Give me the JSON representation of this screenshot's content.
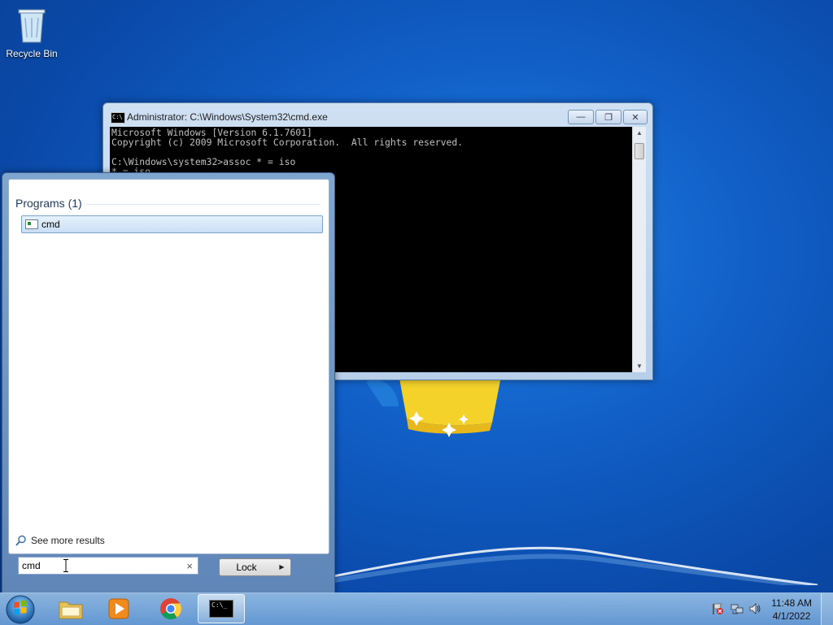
{
  "desktop": {
    "recycle_bin_label": "Recycle Bin"
  },
  "cmd_window": {
    "title": "Administrator: C:\\Windows\\System32\\cmd.exe",
    "icon_text": "C:\\",
    "console_lines": [
      "Microsoft Windows [Version 6.1.7601]",
      "Copyright (c) 2009 Microsoft Corporation.  All rights reserved.",
      "",
      "C:\\Windows\\system32>assoc * = iso",
      "* = iso"
    ],
    "minimize_glyph": "—",
    "restore_glyph": "❐",
    "close_glyph": "✕"
  },
  "start_menu": {
    "programs_header": "Programs (1)",
    "results": [
      {
        "label": "cmd"
      }
    ],
    "see_more": "See more results",
    "search_value": "cmd",
    "clear_glyph": "×",
    "lock_label": "Lock",
    "lock_arrow": "▶"
  },
  "taskbar": {
    "cmd_button_text": "C:\\_",
    "clock_time": "11:48 AM",
    "clock_date": "4/1/2022"
  },
  "colors": {
    "desktop_blue": "#1160c8",
    "console_bg": "#000000",
    "console_text": "#c0c0c0",
    "selection": "#c9dff6"
  }
}
